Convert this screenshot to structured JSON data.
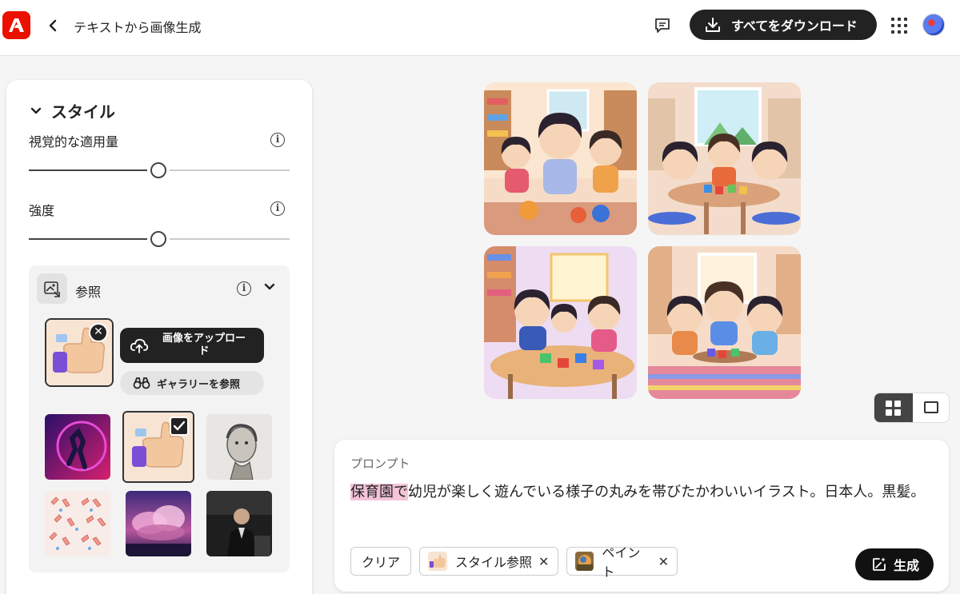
{
  "header": {
    "title": "テキストから画像生成",
    "download_label": "すべてをダウンロード"
  },
  "panel": {
    "section_title": "スタイル",
    "visual_intensity_label": "視覚的な適用量",
    "visual_intensity_value": 0.5,
    "strength_label": "強度",
    "strength_value": 0.5,
    "reference": {
      "label": "参照",
      "upload_label": "画像をアップロード",
      "gallery_label": "ギャラリーを参照"
    }
  },
  "prompt": {
    "label": "プロンプト",
    "highlighted": "保育園で",
    "text": "幼児が楽しく遊んでいる様子の丸みを帯びたかわいいイラスト。日本人。黒髪。",
    "clear_label": "クリア",
    "chips": [
      {
        "label": "スタイル参照"
      },
      {
        "label": "ペイント"
      }
    ],
    "generate_label": "生成"
  },
  "colors": {
    "accent": "#eb1000",
    "dark": "#222222",
    "highlight": "#f4c4d8"
  }
}
